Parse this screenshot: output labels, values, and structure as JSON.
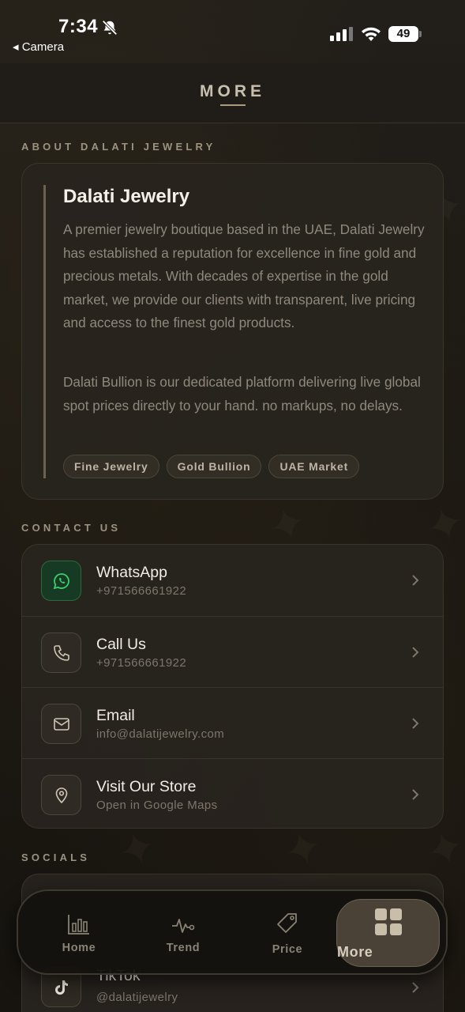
{
  "status_bar": {
    "time": "7:34",
    "back_label": "Camera",
    "battery": "49"
  },
  "header": {
    "title": "MORE"
  },
  "about": {
    "section_label": "ABOUT DALATI JEWELRY",
    "title": "Dalati Jewelry",
    "paragraph1": "A premier jewelry boutique based in the UAE, Dalati Jewelry has established a reputation for excellence in fine gold and precious metals. With decades of expertise in the gold market, we provide our clients with transparent, live pricing and access to the finest gold products.",
    "paragraph2": "Dalati Bullion is our dedicated platform delivering live global spot prices directly to your hand. no markups, no delays.",
    "tags": [
      "Fine Jewelry",
      "Gold Bullion",
      "UAE Market"
    ]
  },
  "contact": {
    "section_label": "CONTACT US",
    "items": [
      {
        "title": "WhatsApp",
        "subtitle": "+971566661922",
        "icon": "whatsapp-icon"
      },
      {
        "title": "Call Us",
        "subtitle": "+971566661922",
        "icon": "phone-icon"
      },
      {
        "title": "Email",
        "subtitle": "info@dalatijewelry.com",
        "icon": "mail-icon"
      },
      {
        "title": "Visit Our Store",
        "subtitle": "Open in Google Maps",
        "icon": "map-pin-icon"
      }
    ]
  },
  "socials": {
    "section_label": "SOCIALS",
    "items": [
      {
        "title": "TikTok",
        "subtitle": "@dalatijewelry",
        "icon": "tiktok-icon"
      }
    ]
  },
  "tabbar": {
    "items": [
      {
        "label": "Home",
        "icon": "bar-chart-icon",
        "active": false
      },
      {
        "label": "Trend",
        "icon": "pulse-icon",
        "active": false
      },
      {
        "label": "Price",
        "icon": "tag-icon",
        "active": false
      },
      {
        "label": "More",
        "icon": "grid-icon",
        "active": true
      }
    ]
  },
  "colors": {
    "background": "#1b1813",
    "accent": "#a99a80",
    "whatsapp": "#3ecf6b"
  }
}
